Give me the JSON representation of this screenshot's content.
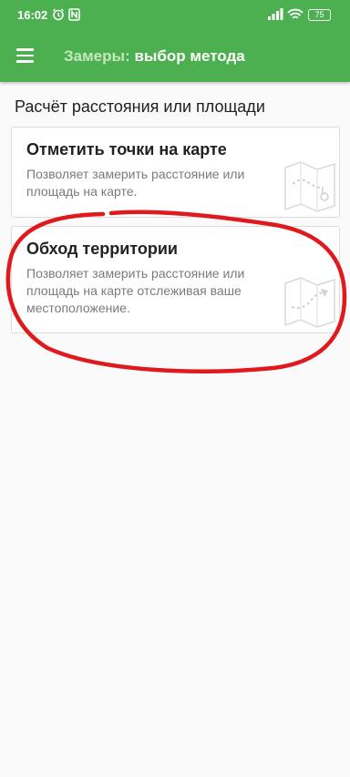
{
  "status_bar": {
    "time": "16:02",
    "battery": "75"
  },
  "app_bar": {
    "title_prefix": "Замеры:",
    "title_main": "выбор метода",
    "menu_icon": "hamburger-menu-icon"
  },
  "section_title": "Расчёт расстояния или площади",
  "methods": [
    {
      "title": "Отметить точки на карте",
      "description": "Позволяет замерить расстояние или площадь на карте.",
      "icon": "map-tap-icon"
    },
    {
      "title": "Обход территории",
      "description": "Позволяет замерить расстояние или площадь на карте отслеживая ваше местоположение.",
      "icon": "map-route-icon"
    }
  ],
  "colors": {
    "primary": "#4caf50",
    "annotation": "#e0191c"
  }
}
